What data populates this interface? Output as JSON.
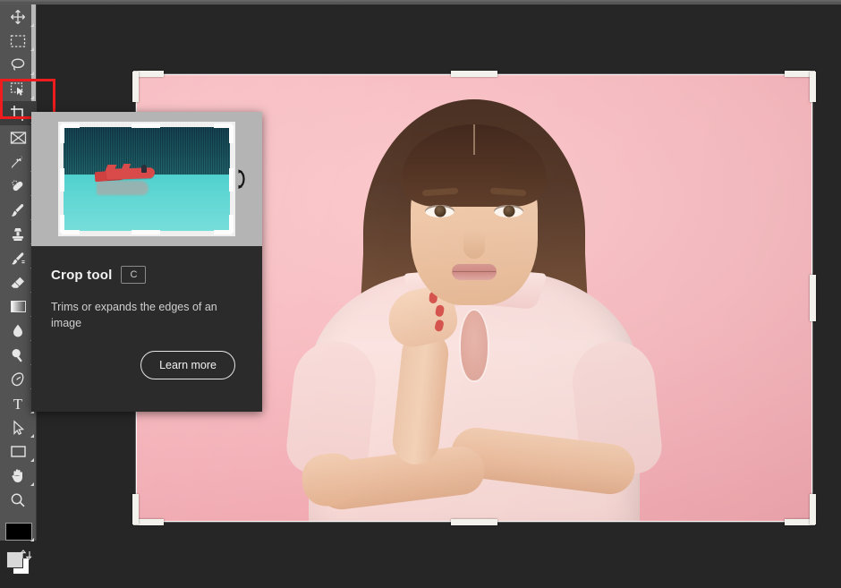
{
  "app": {
    "name": "Adobe Photoshop",
    "canvas_bg_color": "#262626",
    "toolbar_bg_color": "#535353",
    "accent_highlight_color": "#EE1C1C"
  },
  "toolbar": {
    "name": "tools-panel",
    "tools": [
      {
        "id": "move",
        "label": "Move tool",
        "icon": "move-icon",
        "shortcut": "V",
        "has_flyout": true,
        "selected": false
      },
      {
        "id": "rectangular-marquee",
        "label": "Rectangular Marquee tool",
        "icon": "marquee-icon",
        "shortcut": "M",
        "has_flyout": true,
        "selected": false
      },
      {
        "id": "lasso",
        "label": "Lasso tool",
        "icon": "lasso-icon",
        "shortcut": "L",
        "has_flyout": true,
        "selected": false
      },
      {
        "id": "object-selection",
        "label": "Object Selection tool",
        "icon": "object-selection-icon",
        "shortcut": "W",
        "has_flyout": true,
        "selected": false
      },
      {
        "id": "crop",
        "label": "Crop tool",
        "icon": "crop-icon",
        "shortcut": "C",
        "has_flyout": true,
        "selected": true
      },
      {
        "id": "frame",
        "label": "Frame tool",
        "icon": "frame-icon",
        "shortcut": "K",
        "has_flyout": false,
        "selected": false
      },
      {
        "id": "eyedropper",
        "label": "Eyedropper tool",
        "icon": "eyedropper-icon",
        "shortcut": "I",
        "has_flyout": true,
        "selected": false
      },
      {
        "id": "healing-brush",
        "label": "Spot Healing Brush tool",
        "icon": "healing-brush-icon",
        "shortcut": "J",
        "has_flyout": true,
        "selected": false
      },
      {
        "id": "brush",
        "label": "Brush tool",
        "icon": "brush-icon",
        "shortcut": "B",
        "has_flyout": true,
        "selected": false
      },
      {
        "id": "clone-stamp",
        "label": "Clone Stamp tool",
        "icon": "clone-stamp-icon",
        "shortcut": "S",
        "has_flyout": true,
        "selected": false
      },
      {
        "id": "history-brush",
        "label": "History Brush tool",
        "icon": "history-brush-icon",
        "shortcut": "Y",
        "has_flyout": true,
        "selected": false
      },
      {
        "id": "eraser",
        "label": "Eraser tool",
        "icon": "eraser-icon",
        "shortcut": "E",
        "has_flyout": true,
        "selected": false
      },
      {
        "id": "gradient",
        "label": "Gradient tool",
        "icon": "gradient-icon",
        "shortcut": "G",
        "has_flyout": true,
        "selected": false
      },
      {
        "id": "blur",
        "label": "Blur tool",
        "icon": "blur-drop-icon",
        "shortcut": "",
        "has_flyout": true,
        "selected": false
      },
      {
        "id": "dodge",
        "label": "Dodge tool",
        "icon": "dodge-icon",
        "shortcut": "O",
        "has_flyout": true,
        "selected": false
      },
      {
        "id": "pen",
        "label": "Pen tool",
        "icon": "pen-icon",
        "shortcut": "P",
        "has_flyout": true,
        "selected": false
      },
      {
        "id": "type",
        "label": "Horizontal Type tool",
        "icon": "type-t-icon",
        "shortcut": "T",
        "has_flyout": true,
        "selected": false
      },
      {
        "id": "path-selection",
        "label": "Path Selection tool",
        "icon": "path-arrow-icon",
        "shortcut": "A",
        "has_flyout": true,
        "selected": false
      },
      {
        "id": "rectangle",
        "label": "Rectangle tool",
        "icon": "rectangle-icon",
        "shortcut": "U",
        "has_flyout": true,
        "selected": false
      },
      {
        "id": "hand",
        "label": "Hand tool",
        "icon": "hand-icon",
        "shortcut": "H",
        "has_flyout": true,
        "selected": false
      },
      {
        "id": "zoom",
        "label": "Zoom tool",
        "icon": "magnifier-icon",
        "shortcut": "Z",
        "has_flyout": false,
        "selected": false
      },
      {
        "id": "edit-toolbar",
        "label": "Edit Toolbar",
        "icon": "ellipsis-icon",
        "shortcut": "",
        "has_flyout": true,
        "selected": false
      }
    ],
    "colors": {
      "foreground_label": "Set foreground color",
      "background_label": "Set background color",
      "swap_label": "Switch foreground and background colors",
      "foreground_color": "#D8D8D8",
      "background_color": "#FFFFFF"
    },
    "quick_mask_label": "Edit in Quick Mask Mode"
  },
  "tooltip": {
    "name": "crop-tool-tooltip",
    "title": "Crop tool",
    "shortcut": "C",
    "description": "Trims or expands the edges of an image",
    "learn_more_label": "Learn more",
    "preview": {
      "alt": "Canoe on a turquoise lake demonstrating the crop tool",
      "replay_label": "Replay animation"
    }
  },
  "document": {
    "name": "portrait-document",
    "alt": "Young woman with long brown hair in a pale pink top against a pink backdrop",
    "backdrop_color": "#F7BCC1",
    "crop_overlay": {
      "active": true,
      "handle_color": "#F3F1EC",
      "handles": [
        "top-left",
        "top-center",
        "top-right",
        "middle-left",
        "middle-right",
        "bottom-left",
        "bottom-center",
        "bottom-right"
      ]
    }
  }
}
